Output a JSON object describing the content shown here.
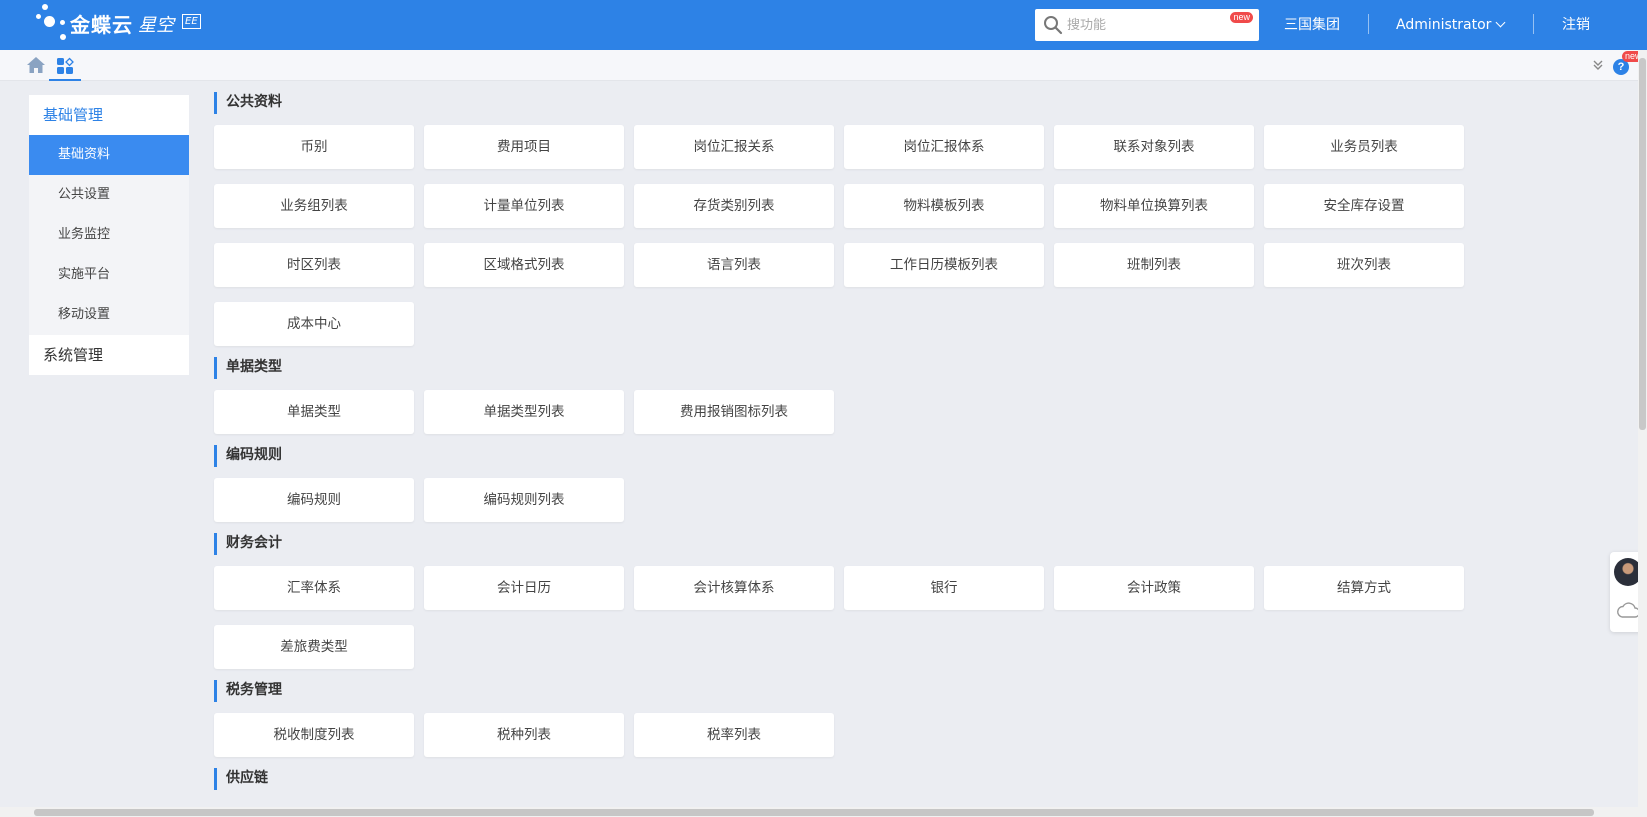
{
  "app": {
    "logo_text": "金蝶云",
    "logo_sub": "星空",
    "logo_edition": "EE"
  },
  "header": {
    "search_placeholder": "搜功能",
    "search_badge": "new",
    "org": "三国集团",
    "user": "Administrator",
    "logout": "注销"
  },
  "tabbar": {
    "help": "?",
    "help_badge": "new"
  },
  "sidebar": {
    "groups": [
      {
        "label": "基础管理",
        "items": [
          "基础资料",
          "公共设置",
          "业务监控",
          "实施平台",
          "移动设置"
        ]
      },
      {
        "label": "系统管理"
      }
    ]
  },
  "sections": [
    {
      "title": "公共资料",
      "tiles": [
        "币别",
        "费用项目",
        "岗位汇报关系",
        "岗位汇报体系",
        "联系对象列表",
        "业务员列表",
        "业务组列表",
        "计量单位列表",
        "存货类别列表",
        "物料模板列表",
        "物料单位换算列表",
        "安全库存设置",
        "时区列表",
        "区域格式列表",
        "语言列表",
        "工作日历模板列表",
        "班制列表",
        "班次列表",
        "成本中心"
      ]
    },
    {
      "title": "单据类型",
      "tiles": [
        "单据类型",
        "单据类型列表",
        "费用报销图标列表"
      ]
    },
    {
      "title": "编码规则",
      "tiles": [
        "编码规则",
        "编码规则列表"
      ]
    },
    {
      "title": "财务会计",
      "tiles": [
        "汇率体系",
        "会计日历",
        "会计核算体系",
        "银行",
        "会计政策",
        "结算方式",
        "差旅费类型"
      ]
    },
    {
      "title": "税务管理",
      "tiles": [
        "税收制度列表",
        "税种列表",
        "税率列表"
      ]
    },
    {
      "title": "供应链",
      "tiles": []
    }
  ],
  "colors": {
    "brand": "#2d82e6",
    "sidebar_active": "#3a8bf0",
    "background": "#ebedf2"
  }
}
